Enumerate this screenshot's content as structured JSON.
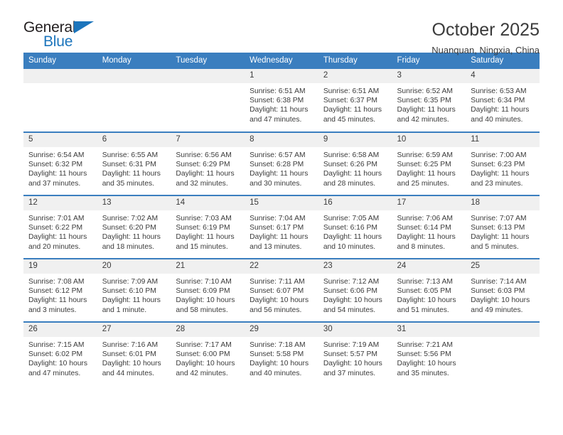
{
  "brand": {
    "name_part1": "General",
    "name_part2": "Blue",
    "accent_color": "#1c75bc"
  },
  "header": {
    "title": "October 2025",
    "location": "Nuanquan, Ningxia, China"
  },
  "theme": {
    "header_blue": "#3a7ebf",
    "daynum_band": "#f0f0f0",
    "text": "#3b3b3b"
  },
  "weekday_headers": [
    "Sunday",
    "Monday",
    "Tuesday",
    "Wednesday",
    "Thursday",
    "Friday",
    "Saturday"
  ],
  "labels": {
    "sunrise_prefix": "Sunrise:",
    "sunset_prefix": "Sunset:",
    "daylight_prefix": "Daylight:"
  },
  "weeks": [
    [
      {
        "day": "",
        "empty": true
      },
      {
        "day": "",
        "empty": true
      },
      {
        "day": "",
        "empty": true
      },
      {
        "day": "1",
        "sunrise": "Sunrise: 6:51 AM",
        "sunset": "Sunset: 6:38 PM",
        "daylight_line1": "Daylight: 11 hours",
        "daylight_line2": "and 47 minutes."
      },
      {
        "day": "2",
        "sunrise": "Sunrise: 6:51 AM",
        "sunset": "Sunset: 6:37 PM",
        "daylight_line1": "Daylight: 11 hours",
        "daylight_line2": "and 45 minutes."
      },
      {
        "day": "3",
        "sunrise": "Sunrise: 6:52 AM",
        "sunset": "Sunset: 6:35 PM",
        "daylight_line1": "Daylight: 11 hours",
        "daylight_line2": "and 42 minutes."
      },
      {
        "day": "4",
        "sunrise": "Sunrise: 6:53 AM",
        "sunset": "Sunset: 6:34 PM",
        "daylight_line1": "Daylight: 11 hours",
        "daylight_line2": "and 40 minutes."
      }
    ],
    [
      {
        "day": "5",
        "sunrise": "Sunrise: 6:54 AM",
        "sunset": "Sunset: 6:32 PM",
        "daylight_line1": "Daylight: 11 hours",
        "daylight_line2": "and 37 minutes."
      },
      {
        "day": "6",
        "sunrise": "Sunrise: 6:55 AM",
        "sunset": "Sunset: 6:31 PM",
        "daylight_line1": "Daylight: 11 hours",
        "daylight_line2": "and 35 minutes."
      },
      {
        "day": "7",
        "sunrise": "Sunrise: 6:56 AM",
        "sunset": "Sunset: 6:29 PM",
        "daylight_line1": "Daylight: 11 hours",
        "daylight_line2": "and 32 minutes."
      },
      {
        "day": "8",
        "sunrise": "Sunrise: 6:57 AM",
        "sunset": "Sunset: 6:28 PM",
        "daylight_line1": "Daylight: 11 hours",
        "daylight_line2": "and 30 minutes."
      },
      {
        "day": "9",
        "sunrise": "Sunrise: 6:58 AM",
        "sunset": "Sunset: 6:26 PM",
        "daylight_line1": "Daylight: 11 hours",
        "daylight_line2": "and 28 minutes."
      },
      {
        "day": "10",
        "sunrise": "Sunrise: 6:59 AM",
        "sunset": "Sunset: 6:25 PM",
        "daylight_line1": "Daylight: 11 hours",
        "daylight_line2": "and 25 minutes."
      },
      {
        "day": "11",
        "sunrise": "Sunrise: 7:00 AM",
        "sunset": "Sunset: 6:23 PM",
        "daylight_line1": "Daylight: 11 hours",
        "daylight_line2": "and 23 minutes."
      }
    ],
    [
      {
        "day": "12",
        "sunrise": "Sunrise: 7:01 AM",
        "sunset": "Sunset: 6:22 PM",
        "daylight_line1": "Daylight: 11 hours",
        "daylight_line2": "and 20 minutes."
      },
      {
        "day": "13",
        "sunrise": "Sunrise: 7:02 AM",
        "sunset": "Sunset: 6:20 PM",
        "daylight_line1": "Daylight: 11 hours",
        "daylight_line2": "and 18 minutes."
      },
      {
        "day": "14",
        "sunrise": "Sunrise: 7:03 AM",
        "sunset": "Sunset: 6:19 PM",
        "daylight_line1": "Daylight: 11 hours",
        "daylight_line2": "and 15 minutes."
      },
      {
        "day": "15",
        "sunrise": "Sunrise: 7:04 AM",
        "sunset": "Sunset: 6:17 PM",
        "daylight_line1": "Daylight: 11 hours",
        "daylight_line2": "and 13 minutes."
      },
      {
        "day": "16",
        "sunrise": "Sunrise: 7:05 AM",
        "sunset": "Sunset: 6:16 PM",
        "daylight_line1": "Daylight: 11 hours",
        "daylight_line2": "and 10 minutes."
      },
      {
        "day": "17",
        "sunrise": "Sunrise: 7:06 AM",
        "sunset": "Sunset: 6:14 PM",
        "daylight_line1": "Daylight: 11 hours",
        "daylight_line2": "and 8 minutes."
      },
      {
        "day": "18",
        "sunrise": "Sunrise: 7:07 AM",
        "sunset": "Sunset: 6:13 PM",
        "daylight_line1": "Daylight: 11 hours",
        "daylight_line2": "and 5 minutes."
      }
    ],
    [
      {
        "day": "19",
        "sunrise": "Sunrise: 7:08 AM",
        "sunset": "Sunset: 6:12 PM",
        "daylight_line1": "Daylight: 11 hours",
        "daylight_line2": "and 3 minutes."
      },
      {
        "day": "20",
        "sunrise": "Sunrise: 7:09 AM",
        "sunset": "Sunset: 6:10 PM",
        "daylight_line1": "Daylight: 11 hours",
        "daylight_line2": "and 1 minute."
      },
      {
        "day": "21",
        "sunrise": "Sunrise: 7:10 AM",
        "sunset": "Sunset: 6:09 PM",
        "daylight_line1": "Daylight: 10 hours",
        "daylight_line2": "and 58 minutes."
      },
      {
        "day": "22",
        "sunrise": "Sunrise: 7:11 AM",
        "sunset": "Sunset: 6:07 PM",
        "daylight_line1": "Daylight: 10 hours",
        "daylight_line2": "and 56 minutes."
      },
      {
        "day": "23",
        "sunrise": "Sunrise: 7:12 AM",
        "sunset": "Sunset: 6:06 PM",
        "daylight_line1": "Daylight: 10 hours",
        "daylight_line2": "and 54 minutes."
      },
      {
        "day": "24",
        "sunrise": "Sunrise: 7:13 AM",
        "sunset": "Sunset: 6:05 PM",
        "daylight_line1": "Daylight: 10 hours",
        "daylight_line2": "and 51 minutes."
      },
      {
        "day": "25",
        "sunrise": "Sunrise: 7:14 AM",
        "sunset": "Sunset: 6:03 PM",
        "daylight_line1": "Daylight: 10 hours",
        "daylight_line2": "and 49 minutes."
      }
    ],
    [
      {
        "day": "26",
        "sunrise": "Sunrise: 7:15 AM",
        "sunset": "Sunset: 6:02 PM",
        "daylight_line1": "Daylight: 10 hours",
        "daylight_line2": "and 47 minutes."
      },
      {
        "day": "27",
        "sunrise": "Sunrise: 7:16 AM",
        "sunset": "Sunset: 6:01 PM",
        "daylight_line1": "Daylight: 10 hours",
        "daylight_line2": "and 44 minutes."
      },
      {
        "day": "28",
        "sunrise": "Sunrise: 7:17 AM",
        "sunset": "Sunset: 6:00 PM",
        "daylight_line1": "Daylight: 10 hours",
        "daylight_line2": "and 42 minutes."
      },
      {
        "day": "29",
        "sunrise": "Sunrise: 7:18 AM",
        "sunset": "Sunset: 5:58 PM",
        "daylight_line1": "Daylight: 10 hours",
        "daylight_line2": "and 40 minutes."
      },
      {
        "day": "30",
        "sunrise": "Sunrise: 7:19 AM",
        "sunset": "Sunset: 5:57 PM",
        "daylight_line1": "Daylight: 10 hours",
        "daylight_line2": "and 37 minutes."
      },
      {
        "day": "31",
        "sunrise": "Sunrise: 7:21 AM",
        "sunset": "Sunset: 5:56 PM",
        "daylight_line1": "Daylight: 10 hours",
        "daylight_line2": "and 35 minutes."
      },
      {
        "day": "",
        "empty": true
      }
    ]
  ]
}
